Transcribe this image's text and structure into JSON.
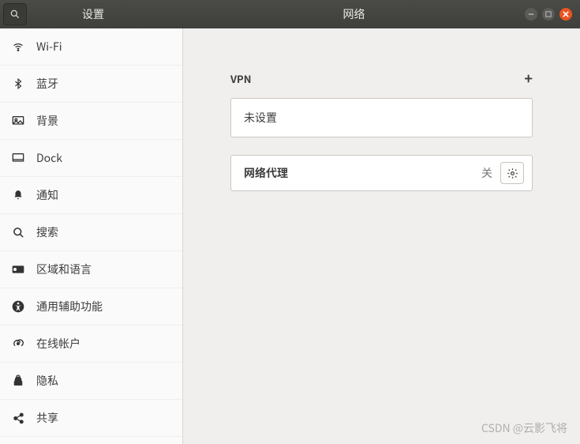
{
  "titlebar": {
    "sidebar_title": "设置",
    "main_title": "网络"
  },
  "sidebar": {
    "items": [
      {
        "label": "Wi-Fi"
      },
      {
        "label": "蓝牙"
      },
      {
        "label": "背景"
      },
      {
        "label": "Dock"
      },
      {
        "label": "通知"
      },
      {
        "label": "搜索"
      },
      {
        "label": "区域和语言"
      },
      {
        "label": "通用辅助功能"
      },
      {
        "label": "在线帐户"
      },
      {
        "label": "隐私"
      },
      {
        "label": "共享"
      }
    ]
  },
  "main": {
    "vpn": {
      "heading": "VPN",
      "empty_text": "未设置"
    },
    "proxy": {
      "label": "网络代理",
      "status": "关"
    }
  },
  "watermark": "CSDN @云影飞将"
}
